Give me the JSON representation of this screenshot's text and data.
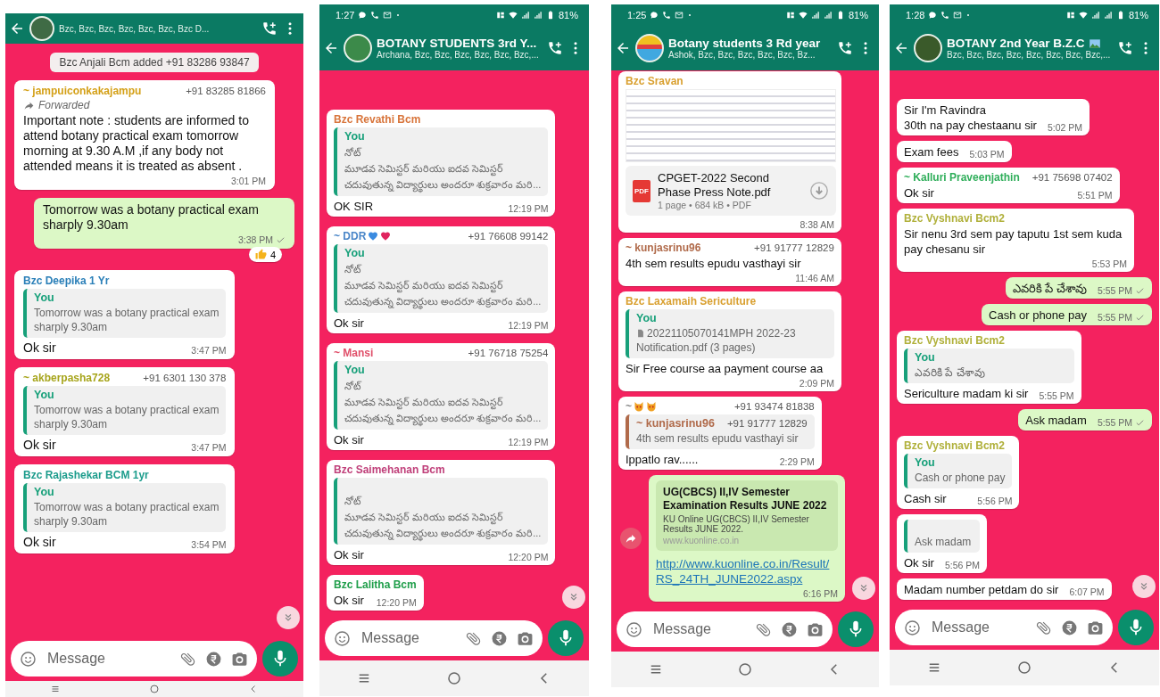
{
  "screens": [
    {
      "header": {
        "subtitle": "Bzc, Bzc, Bzc, Bzc, Bzc, Bzc, Bzc D..."
      },
      "messages": [
        {
          "kind": "system",
          "text": "Bzc Anjali Bcm added +91 83286 93847"
        },
        {
          "kind": "in",
          "sender": "~ jampuiconkakajampu",
          "color": "#d4a017",
          "phone": "+91 83285 81866",
          "forwarded_label": "Forwarded",
          "text": "Important note :  students are informed to attend botany practical exam tomorrow morning at 9.30 A.M ,if any body not attended means it is treated as absent .",
          "time": "3:01 PM"
        },
        {
          "kind": "out",
          "text": "Tomorrow was a botany practical exam sharply 9.30am",
          "time": "3:38 PM",
          "ticked": true,
          "reaction": {
            "count": "4"
          }
        },
        {
          "kind": "in",
          "sender": "Bzc Deepika 1 Yr",
          "color": "#2a7fb8",
          "quote": {
            "author": "You",
            "color": "#17a07a",
            "lines": [
              "Tomorrow was a botany practical exam",
              "sharply 9.30am"
            ]
          },
          "text": "Ok sir",
          "time": "3:47 PM"
        },
        {
          "kind": "in",
          "sender": "~ akberpasha728",
          "color": "#a7a51c",
          "phone": "+91 6301 130 378",
          "quote": {
            "author": "You",
            "color": "#17a07a",
            "lines": [
              "Tomorrow was a botany practical exam",
              "sharply 9.30am"
            ]
          },
          "text": "Ok sir",
          "time": "3:47 PM"
        },
        {
          "kind": "in",
          "sender": "Bzc Rajashekar BCM 1yr",
          "color": "#1c9c8c",
          "quote": {
            "author": "You",
            "color": "#17a07a",
            "lines": [
              "Tomorrow was a botany practical exam",
              "sharply 9.30am"
            ]
          },
          "text": "Ok sir",
          "time": "3:54 PM"
        }
      ],
      "input": {
        "placeholder": "Message"
      }
    },
    {
      "status_bar": {
        "time": "1:27",
        "battery": "81%"
      },
      "header": {
        "title": "BOTANY STUDENTS 3rd Y...",
        "subtitle": "Archana, Bzc, Bzc, Bzc, Bzc, Bzc, Bzc,..."
      },
      "messages": [
        {
          "kind": "in",
          "sender": "Bzc Revathi Bcm",
          "color": "#d8743a",
          "quote": {
            "author": "You",
            "color": "#17a07a",
            "lines": [
              "నోట్",
              "మూడవ సెమిస్టర్ మరియు ఐదవ సెమిస్టర్",
              "చదువుతున్న విద్యార్థులు అందరూ శుక్రవారం మరి..."
            ]
          },
          "text": "OK SIR",
          "time": "12:19 PM"
        },
        {
          "kind": "in",
          "sender": "~ DDR",
          "color": "#4a86c8",
          "badges": [
            {
              "kind": "heart",
              "color": "#3b8be0"
            },
            {
              "kind": "heart",
              "color": "#e0245e"
            }
          ],
          "phone": "+91 76608 99142",
          "quote": {
            "author": "You",
            "color": "#17a07a",
            "lines": [
              "నోట్",
              "మూడవ సెమిస్టర్ మరియు ఐదవ సెమిస్టర్",
              "చదువుతున్న విద్యార్థులు అందరూ శుక్రవారం మరి..."
            ]
          },
          "text": "Ok sir",
          "time": "12:19 PM"
        },
        {
          "kind": "in",
          "sender": "~ Mansi",
          "color": "#e0506a",
          "phone": "+91 76718 75254",
          "quote": {
            "author": "You",
            "color": "#17a07a",
            "lines": [
              "నోట్",
              "మూడవ సెమిస్టర్ మరియు ఐదవ సెమిస్టర్",
              "చదువుతున్న విద్యార్థులు అందరూ శుక్రవారం మరి..."
            ]
          },
          "text": "Ok sir",
          "time": "12:19 PM"
        },
        {
          "kind": "in",
          "sender": "Bzc Saimehanan Bcm",
          "color": "#c0407a",
          "quote": {
            "color": "#17a07a",
            "lines": [
              "నోట్",
              "మూడవ సెమిస్టర్ మరియు ఐదవ సెమిస్టర్",
              "చదువుతున్న విద్యార్థులు అందరూ శుక్రవారం మరి..."
            ]
          },
          "text": "Ok sir",
          "time": "12:20 PM"
        },
        {
          "kind": "in",
          "sender": "Bzc Lalitha Bcm",
          "color": "#1f9e4a",
          "text": "Ok sir",
          "time": "12:20 PM"
        }
      ],
      "input": {
        "placeholder": "Message"
      }
    },
    {
      "status_bar": {
        "time": "1:25",
        "battery": "81%"
      },
      "header": {
        "title": "Botany students 3 Rd year",
        "subtitle": "Ashok, Bzc, Bzc, Bzc, Bzc, Bzc, Bz..."
      },
      "messages": [
        {
          "kind": "in",
          "sender": "Bzc Sravan",
          "color": "#d9a030",
          "document": {
            "badge": "PDF",
            "name": "CPGET-2022 Second Phase Press Note.pdf",
            "meta": "1 page • 684 kB • PDF"
          },
          "time": "8:38 AM"
        },
        {
          "kind": "in",
          "sender": "~ kunjasrinu96",
          "color": "#b06a4a",
          "phone": "+91 91777 12829",
          "text": "4th sem results epudu vasthayi sir",
          "time": "11:46 AM"
        },
        {
          "kind": "in",
          "sender": "Bzc Laxamaih Sericulture",
          "color": "#d9a030",
          "quote": {
            "author": "You",
            "color": "#17a07a",
            "file_icon": true,
            "lines": [
              "20221105070141MPH 2022-23",
              "Notification.pdf (3 pages)"
            ]
          },
          "text": "Sir Free course aa payment course aa",
          "time": "2:09 PM"
        },
        {
          "kind": "in",
          "sender": "~",
          "color": "#8a8a8a",
          "badges": [
            {
              "kind": "face"
            },
            {
              "kind": "face"
            }
          ],
          "phone": "+91 93474 81838",
          "quote": {
            "author": "~ kunjasrinu96",
            "color": "#b06a4a",
            "phone": "+91 91777 12829",
            "lines": [
              "4th sem results epudu vasthayi sir"
            ]
          },
          "text": "Ippatlo rav......",
          "time": "2:29 PM"
        },
        {
          "kind": "out",
          "forward_button": true,
          "link_preview": {
            "title": "UG(CBCS) II,IV Semester Examination Results JUNE 2022",
            "description": "KU Online UG(CBCS) II,IV Semester Results JUNE 2022.",
            "domain": "www.kuonline.co.in"
          },
          "link": "http://www.kuonline.co.in/Result/RS_24TH_JUNE2022.aspx",
          "time": "6:16 PM"
        }
      ],
      "input": {
        "placeholder": "Message"
      }
    },
    {
      "status_bar": {
        "time": "1:28",
        "battery": "81%"
      },
      "header": {
        "title": "BOTANY 2nd Year B.Z.C",
        "title_picture": true,
        "subtitle": "Bzc, Bzc, Bzc, Bzc, Bzc, Bzc, Bzc, Bzc,..."
      },
      "messages": [
        {
          "kind": "in",
          "text": "Sir I'm Ravindra\n30th na pay chestaanu sir",
          "time": "5:02 PM"
        },
        {
          "kind": "in",
          "text": "Exam fees",
          "time": "5:03 PM"
        },
        {
          "kind": "in",
          "sender": "~ Kalluri Praveenjathin",
          "color": "#2fae5a",
          "phone": "+91 75698 07402",
          "text": "Ok sir",
          "time": "5:51 PM"
        },
        {
          "kind": "in",
          "sender": "Bzc Vyshnavi Bcm2",
          "color": "#b0b03a",
          "text": "Sir nenu 3rd sem pay taputu 1st sem kuda pay chesanu sir",
          "time": "5:53 PM"
        },
        {
          "kind": "out",
          "text": "ఎవరికి పే చేశావు",
          "time": "5:55 PM",
          "ticked": true
        },
        {
          "kind": "out",
          "text": "Cash or phone pay",
          "time": "5:55 PM",
          "ticked": true
        },
        {
          "kind": "in",
          "sender": "Bzc Vyshnavi Bcm2",
          "color": "#b0b03a",
          "quote": {
            "author": "You",
            "color": "#17a07a",
            "lines": [
              "ఎవరికి పే చేశావు"
            ]
          },
          "text": "Sericulture madam ki sir",
          "time": "5:55 PM"
        },
        {
          "kind": "out",
          "text": "Ask madam",
          "time": "5:55 PM",
          "ticked": true
        },
        {
          "kind": "in",
          "sender": "Bzc Vyshnavi Bcm2",
          "color": "#b0b03a",
          "quote": {
            "author": "You",
            "color": "#17a07a",
            "lines": [
              "Cash or phone pay"
            ]
          },
          "text": "Cash sir",
          "time": "5:56 PM"
        },
        {
          "kind": "in",
          "quote": {
            "color": "#17a07a",
            "lines": [
              "Ask madam"
            ]
          },
          "text": "Ok sir",
          "time": "5:56 PM"
        },
        {
          "kind": "in",
          "text": "Madam number petdam do sir",
          "time": "6:07 PM"
        }
      ],
      "input": {
        "placeholder": "Message"
      }
    }
  ]
}
